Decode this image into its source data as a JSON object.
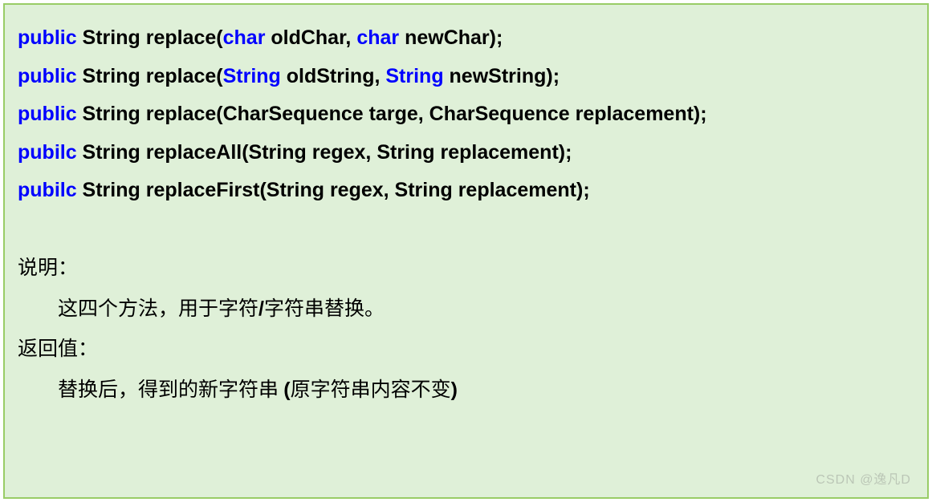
{
  "signatures": [
    {
      "kw1": "public",
      "text1": " String replace(",
      "kw2": "char",
      "text2": " oldChar, ",
      "kw3": "char",
      "text3": " newChar);"
    },
    {
      "kw1": "public",
      "text1": " String replace(",
      "kw2": "String",
      "text2": " oldString, ",
      "kw3": "String",
      "text3": " newString);"
    },
    {
      "kw1": "public",
      "text1": " String replace(CharSequence targe, CharSequence replacement);",
      "kw2": "",
      "text2": "",
      "kw3": "",
      "text3": ""
    },
    {
      "kw1": "pubilc",
      "text1": " String replaceAll(String regex, String replacement);",
      "kw2": "",
      "text2": "",
      "kw3": "",
      "text3": ""
    },
    {
      "kw1": "pubilc",
      "text1": " String replaceFirst(String regex, String replacement);",
      "kw2": "",
      "text2": "",
      "kw3": "",
      "text3": ""
    }
  ],
  "desc": {
    "label1": "说明：",
    "body1_a": "这四个方法，用于字符",
    "body1_slash": "/",
    "body1_b": "字符串替换。",
    "label2": "返回值：",
    "body2_a": "替换后，得到的新字符串 ",
    "body2_paren_open": "(",
    "body2_b": "原字符串内容不变",
    "body2_paren_close": ")"
  },
  "watermark": "CSDN @逸凡D"
}
